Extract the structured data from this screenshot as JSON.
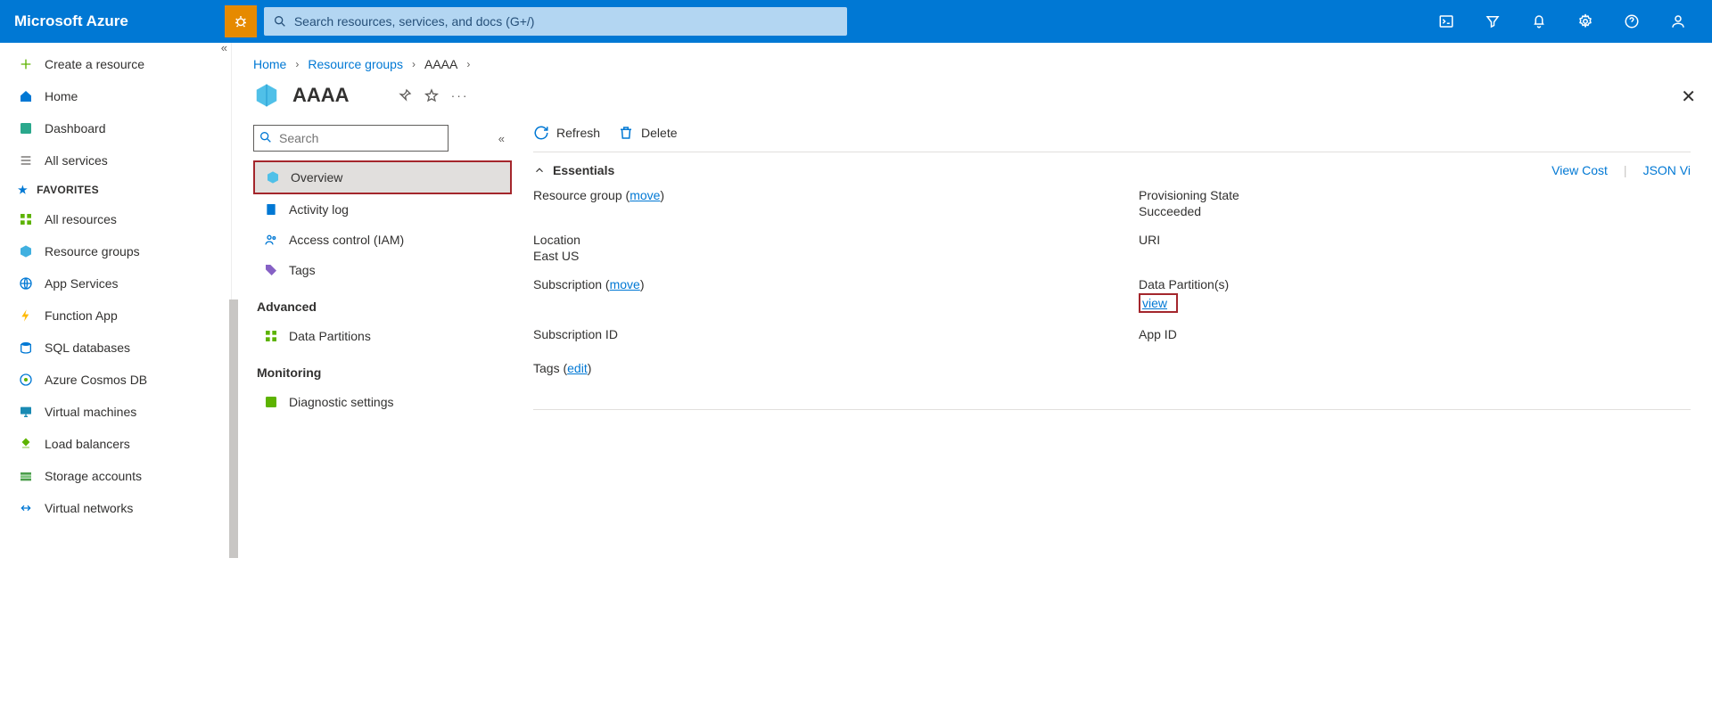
{
  "brand": "Microsoft Azure",
  "search": {
    "placeholder": "Search resources, services, and docs (G+/)"
  },
  "leftnav": {
    "create": "Create a resource",
    "home": "Home",
    "dashboard": "Dashboard",
    "all_services": "All services",
    "favorites_label": "FAVORITES",
    "items": [
      "All resources",
      "Resource groups",
      "App Services",
      "Function App",
      "SQL databases",
      "Azure Cosmos DB",
      "Virtual machines",
      "Load balancers",
      "Storage accounts",
      "Virtual networks"
    ]
  },
  "breadcrumbs": {
    "home": "Home",
    "rg": "Resource groups",
    "current": "AAAA"
  },
  "page": {
    "title": "AAAA"
  },
  "submenu": {
    "search_placeholder": "Search",
    "items": [
      "Overview",
      "Activity log",
      "Access control (IAM)",
      "Tags"
    ],
    "advanced_label": "Advanced",
    "advanced_items": [
      "Data Partitions"
    ],
    "monitoring_label": "Monitoring",
    "monitoring_items": [
      "Diagnostic settings"
    ]
  },
  "toolbar": {
    "refresh": "Refresh",
    "delete": "Delete"
  },
  "essentials": {
    "heading": "Essentials",
    "view_cost": "View Cost",
    "json_view": "JSON Vi",
    "left": {
      "rg_label": "Resource group",
      "rg_move": "move",
      "location_label": "Location",
      "location_value": "East US",
      "sub_label": "Subscription",
      "sub_move": "move",
      "subid_label": "Subscription ID"
    },
    "right": {
      "state_label": "Provisioning State",
      "state_value": "Succeeded",
      "uri_label": "URI",
      "dp_label": "Data Partition(s)",
      "dp_value": "view",
      "appid_label": "App ID"
    },
    "tags_label": "Tags",
    "tags_edit": "edit"
  }
}
